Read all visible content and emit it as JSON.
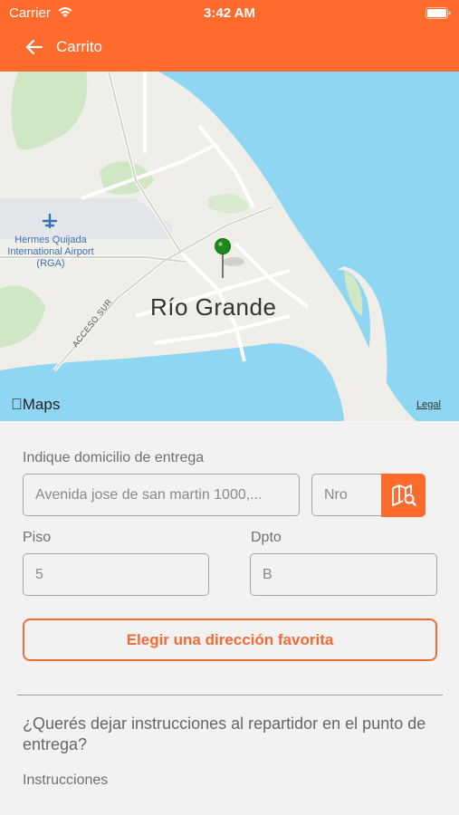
{
  "status_bar": {
    "carrier": "Carrier",
    "time": "3:42 AM"
  },
  "header": {
    "title": "Carrito",
    "back_icon": "arrow-left-icon",
    "background": "#ff6b2d"
  },
  "map": {
    "city_label": "Río Grande",
    "airport_label": "Hermes Quijada International Airport (RGA)",
    "road_label": "ACCESO SUR",
    "maps_brand": "Maps",
    "legal": "Legal",
    "pin_color": "#1a8a1a"
  },
  "form": {
    "address_label": "Indique domicilio de entrega",
    "address_placeholder": "Avenida jose de san martin 1000,...",
    "number_placeholder": "Nro",
    "map_search_icon": "map-search-icon",
    "floor_label": "Piso",
    "floor_placeholder": "5",
    "apt_label": "Dpto",
    "apt_placeholder": "B",
    "favorite_button": "Elegir una dirección favorita",
    "instructions_question": "¿Querés dejar instrucciones al repartidor en el punto de entrega?",
    "instructions_label": "Instrucciones"
  },
  "accent_color": "#f26a35"
}
